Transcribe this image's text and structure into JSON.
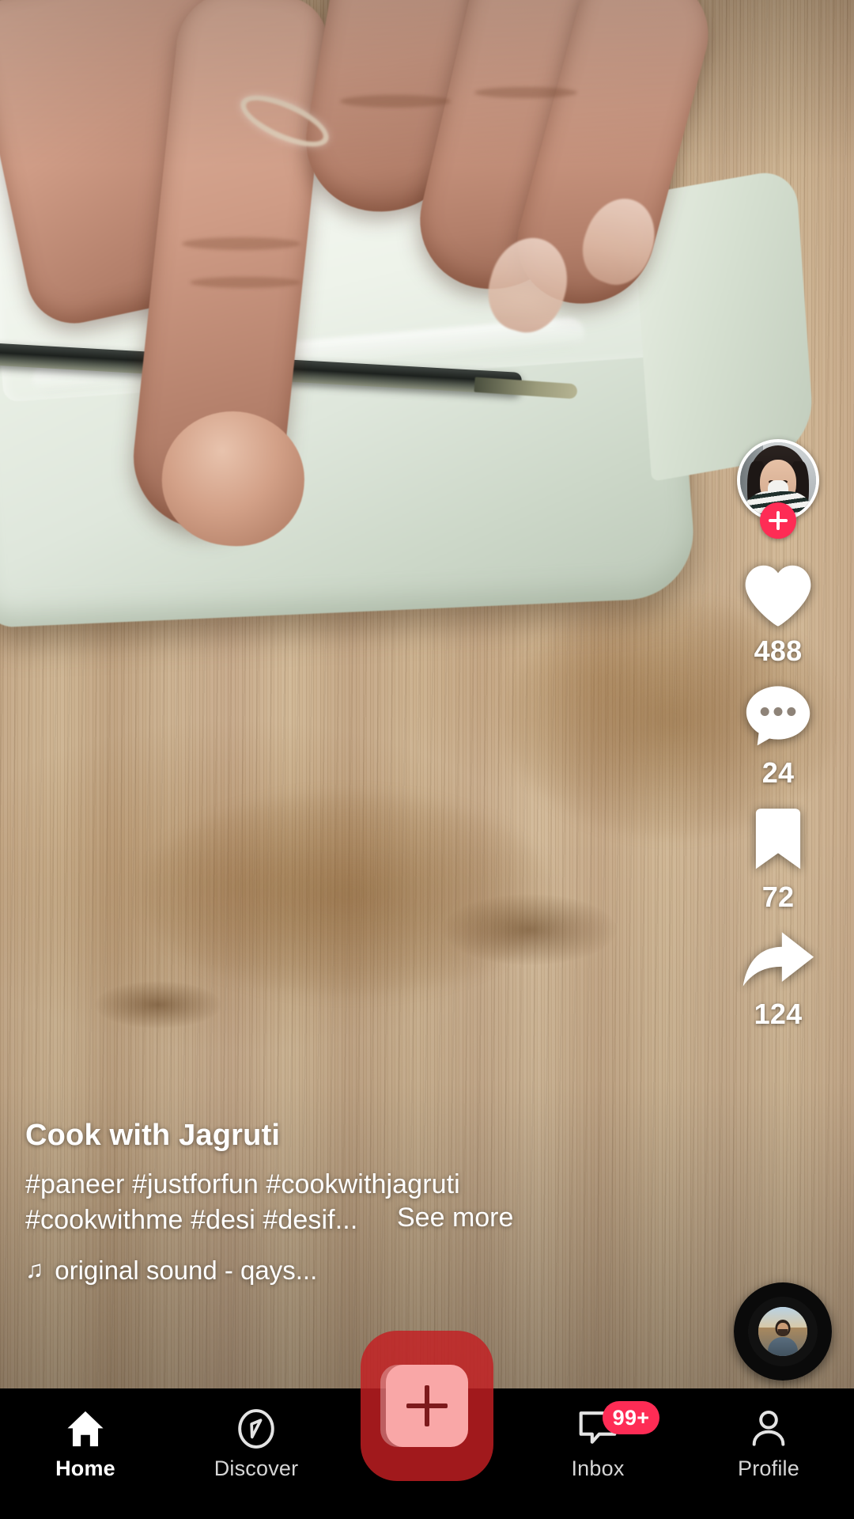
{
  "video": {
    "scene_description": "hands cutting a block of paneer with a knife on a wooden board"
  },
  "rail": {
    "avatar": {
      "name": "avatar",
      "follow_label": "+"
    },
    "actions": [
      {
        "icon": "heart-icon",
        "name": "like",
        "count": "488"
      },
      {
        "icon": "comment-icon",
        "name": "comment",
        "count": "24"
      },
      {
        "icon": "bookmark-icon",
        "name": "bookmark",
        "count": "72"
      },
      {
        "icon": "share-icon",
        "name": "share",
        "count": "124"
      }
    ],
    "music_disc": "music-disc"
  },
  "caption": {
    "username": "Cook with Jagruti",
    "description": "#paneer #justforfun #cookwithjagruti #cookwithme #desi #desif...",
    "see_more": "See more",
    "music_note_icon": "♫",
    "music_title": "original sound - qays..."
  },
  "nav": {
    "items": [
      {
        "label": "Home",
        "icon": "home-icon",
        "active": true
      },
      {
        "label": "Discover",
        "icon": "compass-icon",
        "active": false
      },
      {
        "label": "Inbox",
        "icon": "inbox-icon",
        "active": false,
        "badge": "99+"
      },
      {
        "label": "Profile",
        "icon": "person-icon",
        "active": false
      }
    ],
    "create": {
      "label": "create-video",
      "icon": "plus-icon"
    }
  },
  "colors": {
    "accent_red": "#FE2C55",
    "create_outer": "#C41E22",
    "create_inner": "#F9A7A7",
    "nav_bg": "#000000",
    "text": "#FFFFFF"
  }
}
